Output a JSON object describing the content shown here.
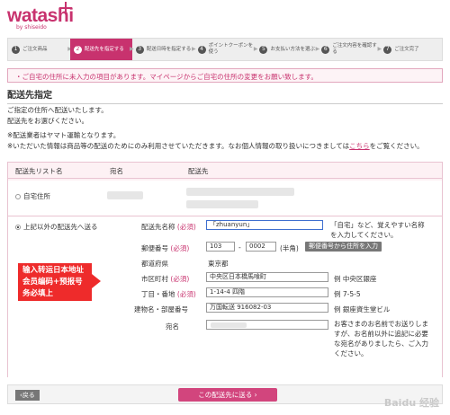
{
  "logo": {
    "brand": "watashi",
    "sub": "by shiseido"
  },
  "steps": [
    {
      "num": "1",
      "label": "ご注文商品"
    },
    {
      "num": "2",
      "label": "配送先を指定する"
    },
    {
      "num": "3",
      "label": "配送日時を指定する"
    },
    {
      "num": "4",
      "label": "ポイントクーポンを使う"
    },
    {
      "num": "5",
      "label": "お支払い方法を選ぶ"
    },
    {
      "num": "6",
      "label": "ご注文内容を確認する"
    },
    {
      "num": "7",
      "label": "ご注文完了"
    }
  ],
  "alert": "・ご自宅の住所に未入力の項目があります。マイページからご自宅の住所の変更をお願い致します。",
  "page_title": "配送先指定",
  "intro": [
    "ご指定の住所へ配送いたします。",
    "配送先をお選びください。"
  ],
  "notes": [
    "※配送業者はヤマト運輸となります。",
    "※いただいた情報は商品等の配送のためにのみ利用させていただきます。なお個人情報の取り扱いにつきましては",
    "こちら",
    "をご覧ください。"
  ],
  "table": {
    "headers": [
      "配送先リスト名",
      "宛名",
      "配送先"
    ],
    "home_option": "自宅住所",
    "other_option": "上記以外の配送先へ送る"
  },
  "form": {
    "list_name_label": "配送先名称",
    "required": "(必須)",
    "list_name_value": "「zhuanyun」",
    "list_name_help": "「自宅」など、覚えやすい名称を入力してください。",
    "postal_label": "郵便番号",
    "postal_1": "103",
    "postal_sep": "-",
    "postal_2": "0002",
    "postal_note": "(半角)",
    "postal_button": "郵便番号から住所を入力",
    "pref_label": "都道府県",
    "pref_value": "東京都",
    "city_label": "市区町村",
    "city_value": "中央区日本橋馬喰町",
    "city_example": "例 中央区銀座",
    "street_label": "丁目・番地",
    "street_value": "1-14-4 四階",
    "street_example": "例 7-5-5",
    "building_label": "建物名・部屋番号",
    "building_value": "万国転送 916082-03",
    "building_example": "例 銀座資生堂ビル",
    "name_label": "宛名",
    "name_help": "お客さまのお名前でお送りしますが、お名前以外に追記に必要な宛名がありましたら、ご入力ください。"
  },
  "annotation": "输入转运日本地址会员编码+预报号务必填上",
  "footer": {
    "back": "戻る",
    "next": "この配送先に送る"
  },
  "watermark": "Baidu 经验"
}
